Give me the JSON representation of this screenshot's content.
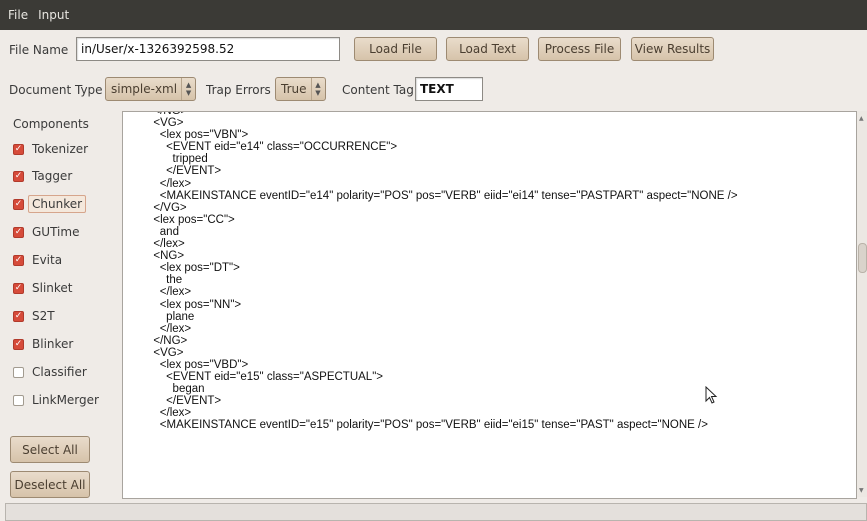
{
  "menu": {
    "file": "File",
    "input": "Input"
  },
  "file_row": {
    "label": "File Name",
    "value": "in/User/x-1326392598.52",
    "load_file": "Load File",
    "load_text": "Load Text",
    "process_file": "Process File",
    "view_results": "View Results"
  },
  "options_row": {
    "doc_type_label": "Document Type",
    "doc_type_value": "simple-xml",
    "trap_errors_label": "Trap Errors",
    "trap_errors_value": "True",
    "content_tag_label": "Content Tag",
    "content_tag_value": "TEXT"
  },
  "components": {
    "title": "Components",
    "items": [
      {
        "label": "Tokenizer",
        "checked": true
      },
      {
        "label": "Tagger",
        "checked": true
      },
      {
        "label": "Chunker",
        "checked": true
      },
      {
        "label": "GUTime",
        "checked": true
      },
      {
        "label": "Evita",
        "checked": true
      },
      {
        "label": "Slinket",
        "checked": true
      },
      {
        "label": "S2T",
        "checked": true
      },
      {
        "label": "Blinker",
        "checked": true
      },
      {
        "label": "Classifier",
        "checked": false
      },
      {
        "label": "LinkMerger",
        "checked": false
      }
    ],
    "select_all": "Select All",
    "deselect_all": "Deselect All"
  },
  "output_lines": [
    "  </NG>",
    "  <VG>",
    "    <lex pos=\"VBN\">",
    "      <EVENT eid=\"e14\" class=\"OCCURRENCE\">",
    "        tripped",
    "      </EVENT>",
    "    </lex>",
    "    <MAKEINSTANCE eventID=\"e14\" polarity=\"POS\" pos=\"VERB\" eiid=\"ei14\" tense=\"PASTPART\" aspect=\"NONE />",
    "  </VG>",
    "  <lex pos=\"CC\">",
    "    and",
    "  </lex>",
    "  <NG>",
    "    <lex pos=\"DT\">",
    "      the",
    "    </lex>",
    "    <lex pos=\"NN\">",
    "      plane",
    "    </lex>",
    "  </NG>",
    "  <VG>",
    "    <lex pos=\"VBD\">",
    "      <EVENT eid=\"e15\" class=\"ASPECTUAL\">",
    "        began",
    "      </EVENT>",
    "    </lex>",
    "    <MAKEINSTANCE eventID=\"e15\" polarity=\"POS\" pos=\"VERB\" eiid=\"ei15\" tense=\"PAST\" aspect=\"NONE />"
  ]
}
